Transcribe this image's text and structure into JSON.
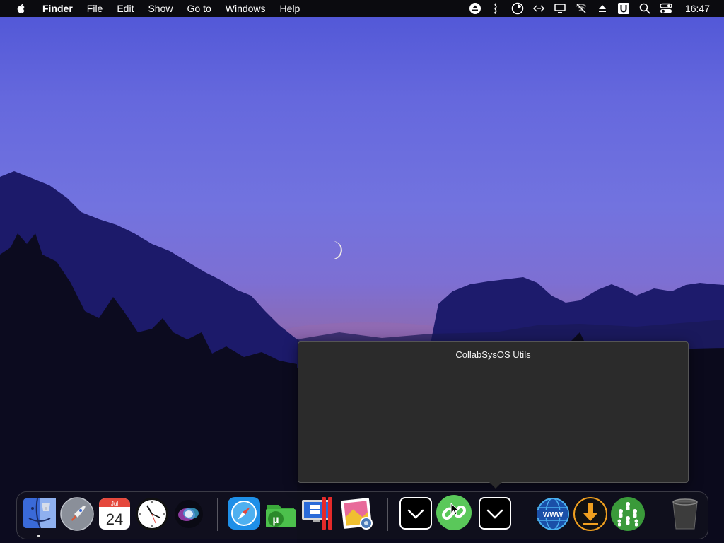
{
  "menubar": {
    "app_name": "Finder",
    "items": [
      "File",
      "Edit",
      "Show",
      "Go to",
      "Windows",
      "Help"
    ],
    "status_icons": [
      "eject-icon",
      "audio-icon",
      "timer-icon",
      "code-icon",
      "display-icon",
      "wifi-off-icon",
      "upload-icon",
      "u-icon",
      "search-icon",
      "control-center-icon"
    ],
    "clock": "16:47"
  },
  "popover": {
    "title": "CollabSysOS Utils"
  },
  "dock": {
    "apps": [
      {
        "name": "finder"
      },
      {
        "name": "launchpad"
      },
      {
        "name": "calendar",
        "month": "Jul",
        "day": "24"
      },
      {
        "name": "clock"
      },
      {
        "name": "siri"
      },
      {
        "name": "safari"
      },
      {
        "name": "utorrent"
      },
      {
        "name": "parallels"
      },
      {
        "name": "preview"
      },
      {
        "name": "dropdown-a"
      },
      {
        "name": "link"
      },
      {
        "name": "dropdown-b"
      },
      {
        "name": "www"
      },
      {
        "name": "download"
      },
      {
        "name": "network"
      },
      {
        "name": "trash"
      }
    ]
  }
}
